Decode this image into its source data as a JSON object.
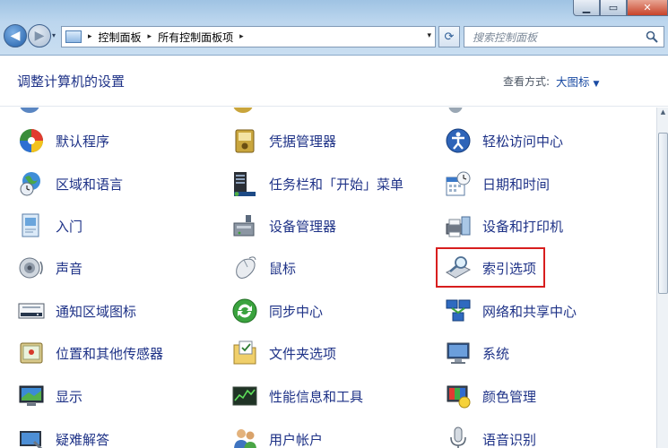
{
  "window": {
    "minimize_glyph": "▁",
    "maximize_glyph": "▭",
    "close_glyph": "✕"
  },
  "nav": {
    "back_glyph": "◀",
    "forward_glyph": "▶",
    "history_glyph": "▾"
  },
  "address": {
    "crumbs": [
      "控制面板",
      "所有控制面板项"
    ],
    "sep_glyph": "▸",
    "drop_glyph": "▾"
  },
  "refresh_glyph": "⟳",
  "search": {
    "placeholder": "搜索控制面板"
  },
  "header": {
    "title": "调整计算机的设置",
    "view_by_label": "查看方式:",
    "view_by_value": "大图标",
    "view_arrow": "▼"
  },
  "items": [
    {
      "label": "默认程序",
      "icon": "default-programs-icon"
    },
    {
      "label": "凭据管理器",
      "icon": "credential-manager-icon"
    },
    {
      "label": "轻松访问中心",
      "icon": "ease-of-access-icon"
    },
    {
      "label": "区域和语言",
      "icon": "region-language-icon"
    },
    {
      "label": "任务栏和「开始」菜单",
      "icon": "taskbar-start-icon"
    },
    {
      "label": "日期和时间",
      "icon": "date-time-icon"
    },
    {
      "label": "入门",
      "icon": "getting-started-icon"
    },
    {
      "label": "设备管理器",
      "icon": "device-manager-icon"
    },
    {
      "label": "设备和打印机",
      "icon": "devices-printers-icon"
    },
    {
      "label": "声音",
      "icon": "sound-icon"
    },
    {
      "label": "鼠标",
      "icon": "mouse-icon"
    },
    {
      "label": "索引选项",
      "icon": "indexing-options-icon"
    },
    {
      "label": "通知区域图标",
      "icon": "notification-area-icon"
    },
    {
      "label": "同步中心",
      "icon": "sync-center-icon"
    },
    {
      "label": "网络和共享中心",
      "icon": "network-sharing-icon"
    },
    {
      "label": "位置和其他传感器",
      "icon": "location-sensors-icon"
    },
    {
      "label": "文件夹选项",
      "icon": "folder-options-icon"
    },
    {
      "label": "系统",
      "icon": "system-icon"
    },
    {
      "label": "显示",
      "icon": "display-icon"
    },
    {
      "label": "性能信息和工具",
      "icon": "performance-icon"
    },
    {
      "label": "颜色管理",
      "icon": "color-management-icon"
    },
    {
      "label": "疑难解答",
      "icon": "troubleshooting-icon"
    },
    {
      "label": "用户帐户",
      "icon": "user-accounts-icon"
    },
    {
      "label": "语音识别",
      "icon": "speech-recognition-icon"
    }
  ],
  "highlighted_item": "索引选项",
  "colors": {
    "link_text": "#1e3287",
    "highlight_border": "#d81e1e",
    "chrome_top": "#9fc3e3"
  }
}
